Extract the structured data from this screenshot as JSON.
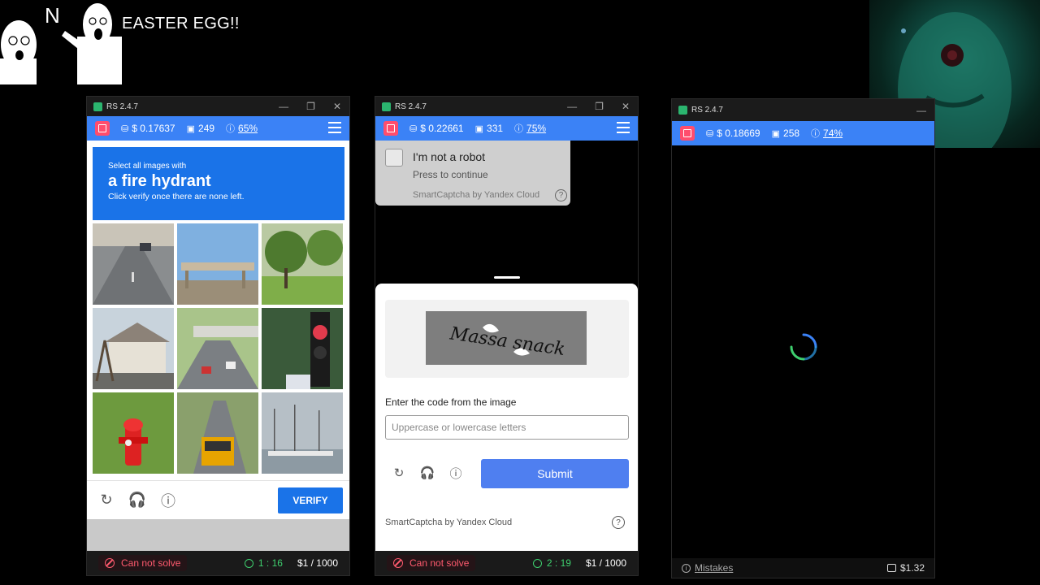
{
  "meme": {
    "caption": "EASTER EGG!!",
    "letter": "N"
  },
  "panes": [
    {
      "title": "RS 2.4.7",
      "balance": "$ 0.17637",
      "count": "249",
      "percent": "65%",
      "footer": {
        "status": "Can not solve",
        "timer": "1 : 16",
        "cost": "$1 / 1000"
      }
    },
    {
      "title": "RS 2.4.7",
      "balance": "$ 0.22661",
      "count": "331",
      "percent": "75%",
      "footer": {
        "status": "Can not solve",
        "timer": "2 : 19",
        "cost": "$1 / 1000"
      }
    },
    {
      "title": "RS 2.4.7",
      "balance": "$ 0.18669",
      "count": "258",
      "percent": "74%",
      "footer": {
        "mistakes": "Mistakes",
        "wallet": "$1.32"
      }
    }
  ],
  "recaptcha": {
    "instruction_small": "Select all images with",
    "instruction_big": "a fire hydrant",
    "instruction_sub": "Click verify once there are none left.",
    "verify_label": "VERIFY",
    "icons": [
      "reload-icon",
      "audio-icon",
      "info-icon"
    ]
  },
  "yandex": {
    "checkbox_label": "I'm not a robot",
    "checkbox_sub": "Press to continue",
    "brand": "SmartCaptcha by Yandex Cloud",
    "captcha_text": "Massa snack",
    "input_label": "Enter the code from the image",
    "input_placeholder": "Uppercase or lowercase letters",
    "submit_label": "Submit",
    "footer_brand": "SmartCaptcha by Yandex Cloud"
  },
  "colors": {
    "accent": "#3b82f6",
    "error": "#ff5a6e",
    "timer": "#3ecf6e",
    "recaptcha_blue": "#1a73e8",
    "yandex_blue": "#4f7ff0"
  }
}
